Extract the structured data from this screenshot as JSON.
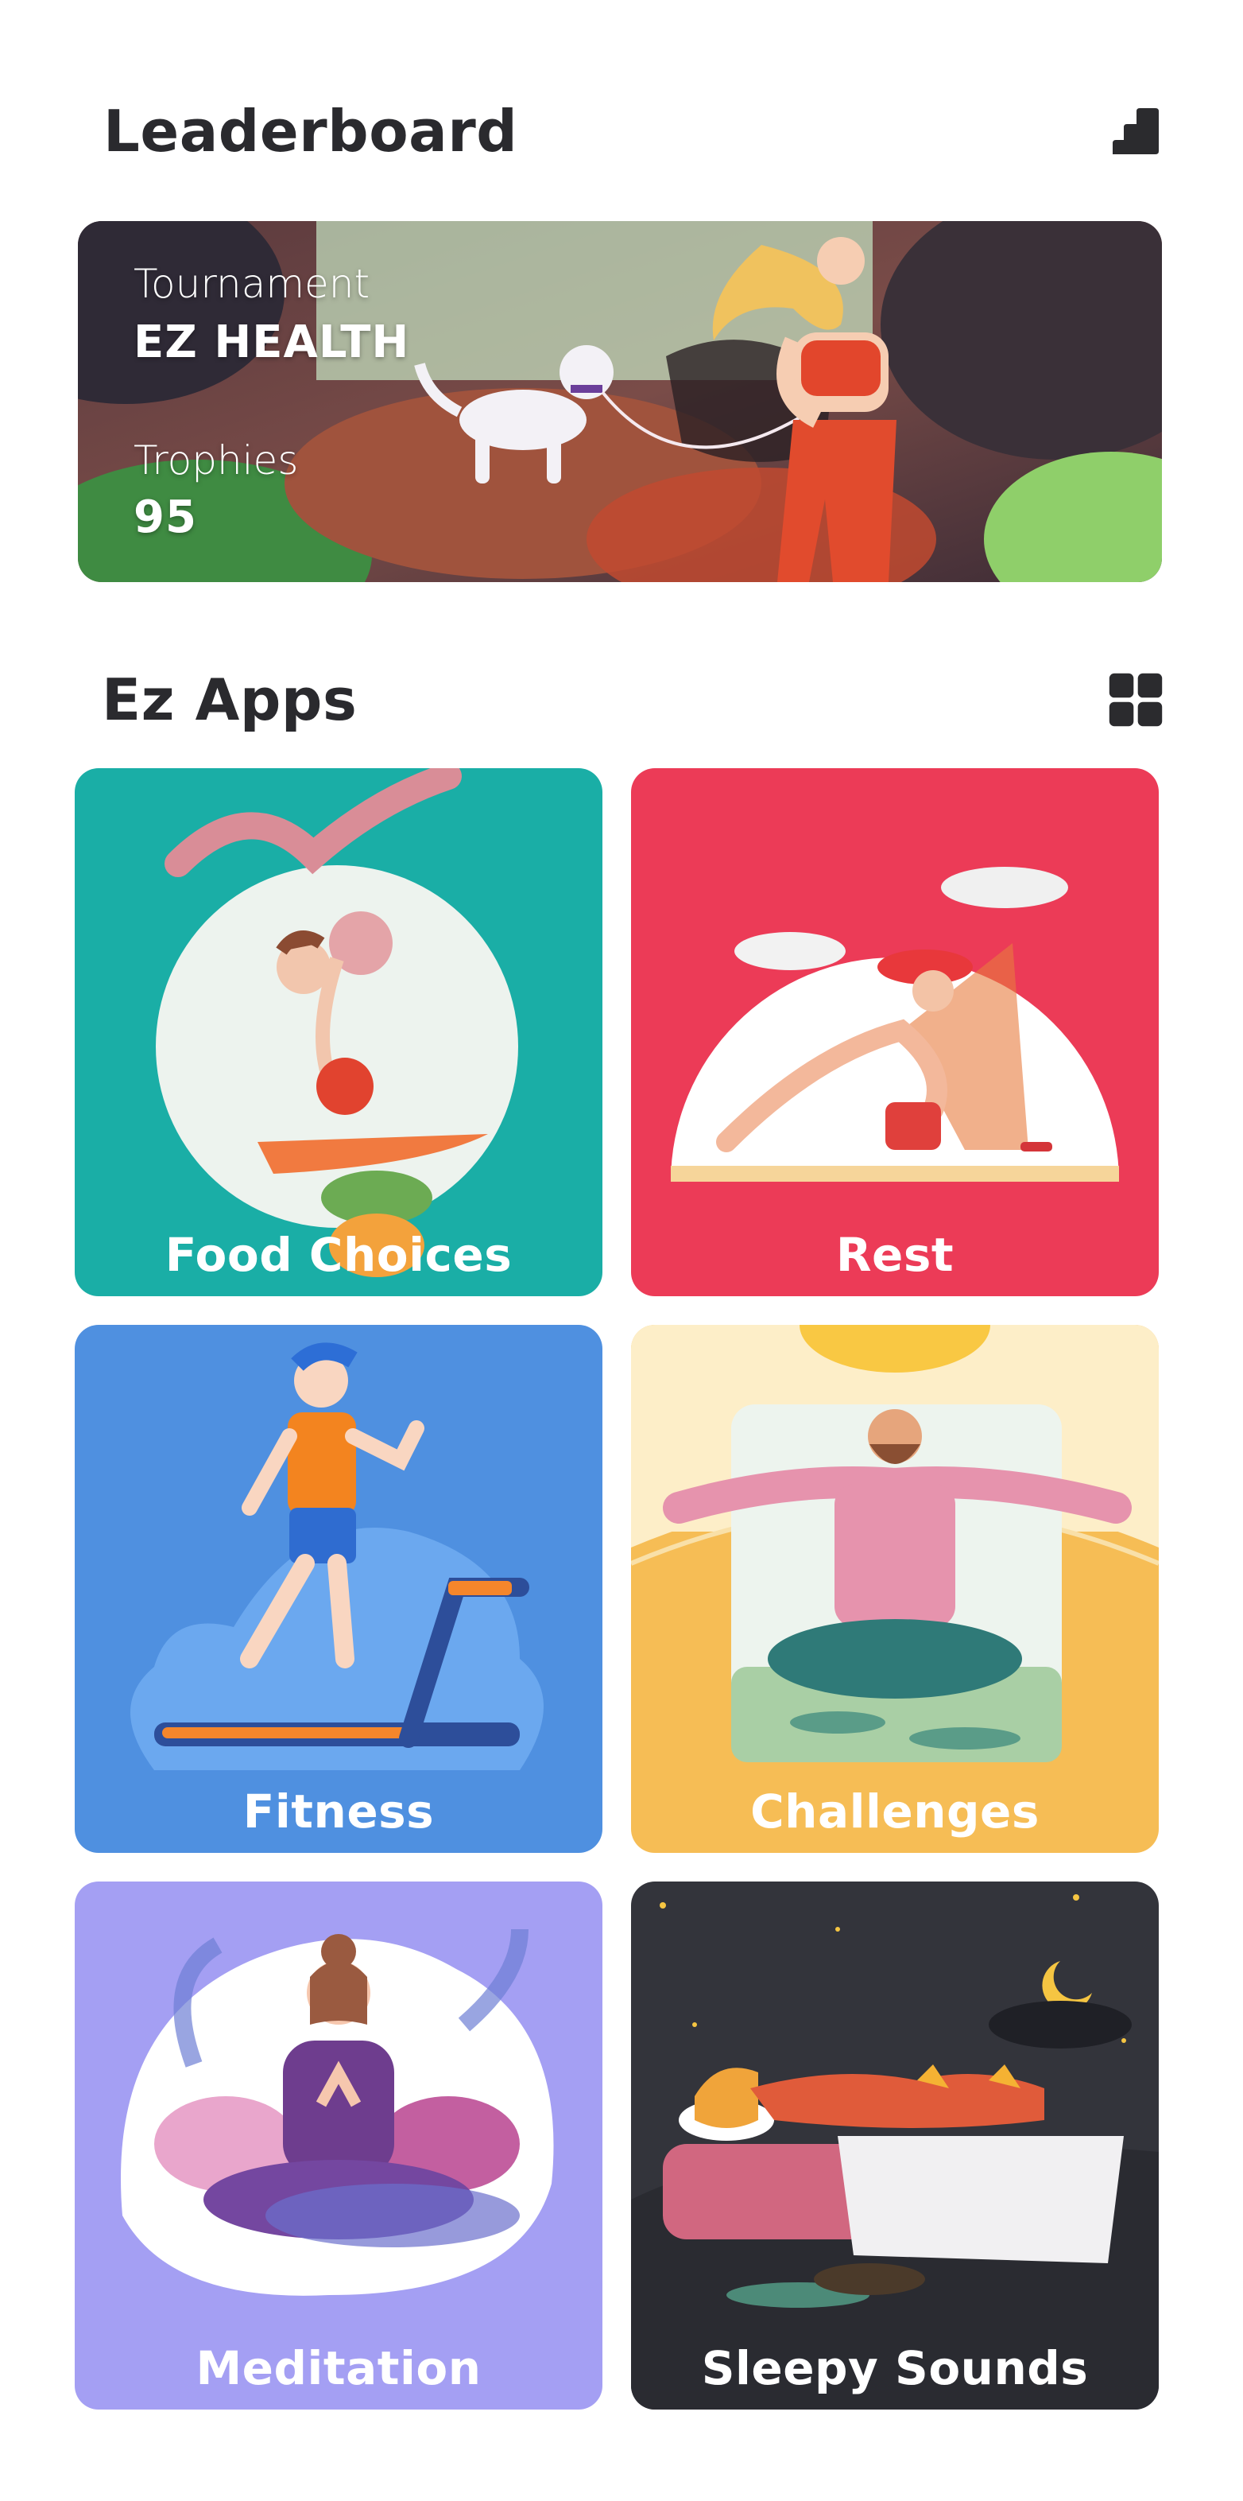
{
  "leaderboard": {
    "title": "Leaderboard",
    "icon": "signal-bars-icon"
  },
  "tournament": {
    "tournament_label": "Tournament",
    "tournament_name": "EZ HEALTH",
    "trophies_label": "Trophies",
    "trophies_value": "95"
  },
  "apps": {
    "title": "Ez Apps",
    "icon": "grid-view-icon",
    "items": [
      {
        "label": "Food Choices",
        "color": "#1aaea6"
      },
      {
        "label": "Rest",
        "color": "#ec3b57"
      },
      {
        "label": "Fitness",
        "color": "#4f90e0"
      },
      {
        "label": "Challenges",
        "color": "#f6bd55"
      },
      {
        "label": "Meditation",
        "color": "#a49ff3"
      },
      {
        "label": "Sleepy Sounds",
        "color": "#33343b"
      }
    ]
  }
}
